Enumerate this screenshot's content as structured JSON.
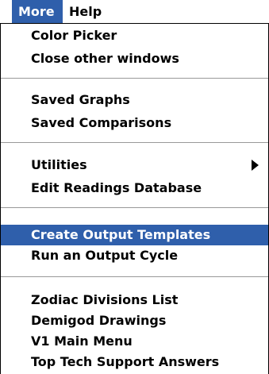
{
  "menubar": {
    "more": "More",
    "help": "Help"
  },
  "menu": {
    "items": [
      {
        "label": "Color Picker"
      },
      {
        "label": "Close other windows"
      },
      {
        "label": "Saved Graphs"
      },
      {
        "label": "Saved Comparisons"
      },
      {
        "label": "Utilities",
        "submenu": true
      },
      {
        "label": "Edit Readings Database"
      },
      {
        "label": "Create Output Templates",
        "selected": true
      },
      {
        "label": "Run an Output Cycle"
      },
      {
        "label": "Zodiac Divisions List"
      },
      {
        "label": "Demigod Drawings"
      },
      {
        "label": "V1 Main Menu"
      },
      {
        "label": "Top Tech Support Answers"
      }
    ]
  },
  "colors": {
    "highlight": "#2f5fab",
    "separator": "#999999"
  },
  "icons": {
    "submenu": "triangle-right-icon"
  }
}
